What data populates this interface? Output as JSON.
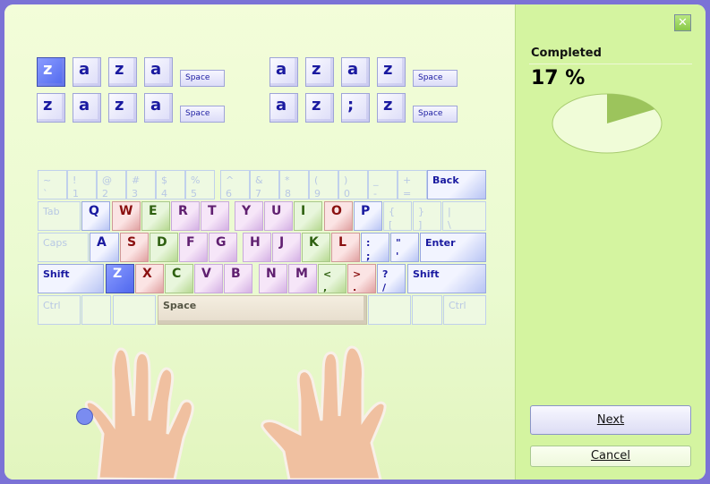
{
  "drill": {
    "row1": [
      "z",
      "a",
      "z",
      "a",
      "Space",
      "a",
      "z",
      "a",
      "z",
      "Space"
    ],
    "row2": [
      "z",
      "a",
      "z",
      "a",
      "Space",
      "a",
      "z",
      ";",
      "z",
      "Space"
    ],
    "active_index": 0
  },
  "keyboard": {
    "rows": [
      [
        [
          "~ `",
          "faded"
        ],
        [
          "! 1",
          "faded"
        ],
        [
          "@ 2",
          "faded"
        ],
        [
          "# 3",
          "faded"
        ],
        [
          "$ 4",
          "faded"
        ],
        [
          "% 5",
          "faded"
        ],
        [
          "^ 6",
          "faded"
        ],
        [
          "& 7",
          "faded"
        ],
        [
          "* 8",
          "faded"
        ],
        [
          "( 9",
          "faded"
        ],
        [
          ") 0",
          "faded"
        ],
        [
          "_ -",
          "faded"
        ],
        [
          "+ =",
          "faded"
        ],
        [
          "Back",
          "blue"
        ]
      ],
      [
        [
          "Tab",
          "faded"
        ],
        [
          "Q",
          "blue"
        ],
        [
          "W",
          "red"
        ],
        [
          "E",
          "green"
        ],
        [
          "R",
          "purple"
        ],
        [
          "T",
          "purple"
        ],
        [
          "Y",
          "purple"
        ],
        [
          "U",
          "purple"
        ],
        [
          "I",
          "green"
        ],
        [
          "O",
          "red"
        ],
        [
          "P",
          "blue"
        ],
        [
          "{ [",
          "faded"
        ],
        [
          "} ]",
          "faded"
        ],
        [
          "| \\",
          "faded"
        ]
      ],
      [
        [
          "Caps",
          "faded"
        ],
        [
          "A",
          "blue"
        ],
        [
          "S",
          "red"
        ],
        [
          "D",
          "green"
        ],
        [
          "F",
          "purple"
        ],
        [
          "G",
          "purple"
        ],
        [
          "H",
          "purple"
        ],
        [
          "J",
          "purple"
        ],
        [
          "K",
          "green"
        ],
        [
          "L",
          "red"
        ],
        [
          ": ;",
          "blue"
        ],
        [
          "\" '",
          "blue"
        ],
        [
          "Enter",
          "blue"
        ]
      ],
      [
        [
          "Shift",
          "blue"
        ],
        [
          "Z",
          "sel"
        ],
        [
          "X",
          "red"
        ],
        [
          "C",
          "green"
        ],
        [
          "V",
          "purple"
        ],
        [
          "B",
          "purple"
        ],
        [
          "N",
          "purple"
        ],
        [
          "M",
          "purple"
        ],
        [
          "< ,",
          "green"
        ],
        [
          "> .",
          "red"
        ],
        [
          "? /",
          "blue"
        ],
        [
          "Shift",
          "blue"
        ]
      ],
      [
        [
          "Ctrl",
          "faded"
        ],
        [
          "",
          "faded"
        ],
        [
          "",
          "faded"
        ],
        [
          "Space",
          "space"
        ],
        [
          "",
          "faded"
        ],
        [
          "",
          "faded"
        ],
        [
          "Ctrl",
          "faded"
        ]
      ]
    ]
  },
  "side": {
    "close_icon": "close-icon",
    "completed_label": "Completed",
    "percent_text": "17 %",
    "progress_percent": 17,
    "next_label": "Next",
    "cancel_label": "Cancel"
  },
  "colors": {
    "pie_fill": "#9cc45c",
    "pie_bg": "#f0fcd8",
    "active_key": "#5a70f0"
  }
}
